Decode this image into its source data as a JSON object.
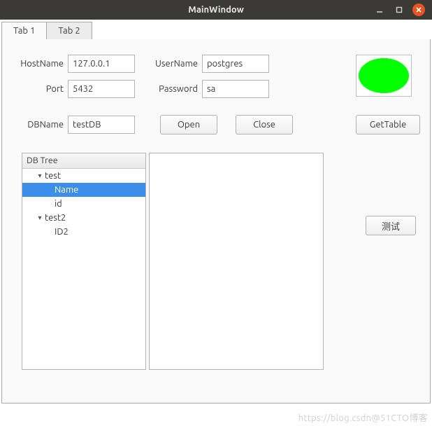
{
  "window": {
    "title": "MainWindow"
  },
  "tabs": [
    {
      "label": "Tab 1",
      "active": true
    },
    {
      "label": "Tab 2",
      "active": false
    }
  ],
  "form": {
    "hostname_label": "HostName",
    "hostname_value": "127.0.0.1",
    "port_label": "Port",
    "port_value": "5432",
    "dbname_label": "DBName",
    "dbname_value": "testDB",
    "username_label": "UserName",
    "username_value": "postgres",
    "password_label": "Password",
    "password_value": "sa"
  },
  "buttons": {
    "open": "Open",
    "close": "Close",
    "gettable": "GetTable",
    "test": "测试"
  },
  "tree": {
    "header": "DB Tree",
    "nodes": [
      {
        "label": "test",
        "expanded": true,
        "children": [
          {
            "label": "Name",
            "selected": true
          },
          {
            "label": "id",
            "selected": false
          }
        ]
      },
      {
        "label": "test2",
        "expanded": true,
        "children": [
          {
            "label": "ID2",
            "selected": false
          }
        ]
      }
    ]
  },
  "indicator": {
    "shape": "ellipse",
    "color": "#00ff00"
  },
  "watermark": "https://blog.csdn@51CTO博客"
}
